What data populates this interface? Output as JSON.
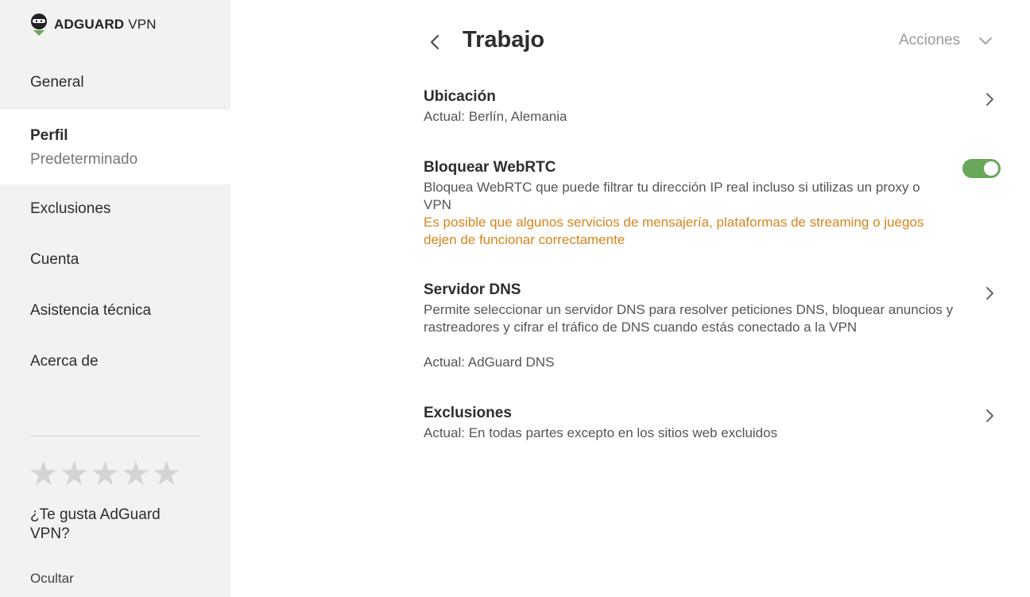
{
  "app": {
    "brand_bold": "ADGUARD",
    "brand_light": "VPN"
  },
  "sidebar": {
    "items": [
      {
        "label": "General"
      },
      {
        "label": "Perfil",
        "subtitle": "Predeterminado"
      },
      {
        "label": "Exclusiones"
      },
      {
        "label": "Cuenta"
      },
      {
        "label": "Asistencia técnica"
      },
      {
        "label": "Acerca de"
      }
    ],
    "rating": {
      "stars": 5,
      "filled": 0,
      "question": "¿Te gusta AdGuard VPN?",
      "hide_label": "Ocultar"
    }
  },
  "header": {
    "title": "Trabajo",
    "actions_label": "Acciones"
  },
  "settings": {
    "location": {
      "title": "Ubicación",
      "current": "Actual: Berlín, Alemania"
    },
    "webrtc": {
      "title": "Bloquear WebRTC",
      "description": "Bloquea WebRTC que puede filtrar tu dirección IP real incluso si utilizas un proxy o VPN",
      "warning": "Es posible que algunos servicios de mensajería, plataformas de streaming o juegos dejen de funcionar correctamente",
      "enabled": true
    },
    "dns": {
      "title": "Servidor DNS",
      "description": "Permite seleccionar un servidor DNS para resolver peticiones DNS, bloquear anuncios y rastreadores y cifrar el tráfico de DNS cuando estás conectado a la VPN",
      "current": "Actual: AdGuard DNS"
    },
    "exclusions": {
      "title": "Exclusiones",
      "current": "Actual: En todas partes excepto en los sitios web excluidos"
    }
  },
  "colors": {
    "accent_green": "#68a65a",
    "warning_orange": "#d5851e",
    "sidebar_bg": "#f2f2f2"
  }
}
